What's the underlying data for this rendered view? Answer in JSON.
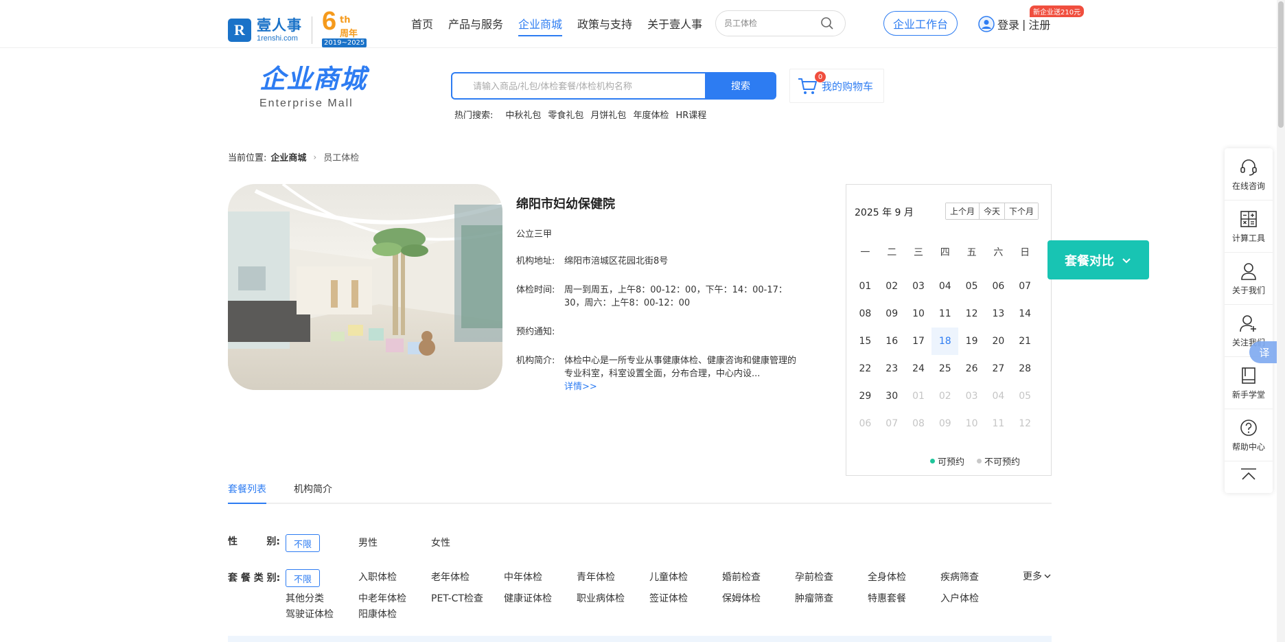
{
  "topnav": {
    "logo_cn": "壹人事",
    "logo_en": "1renshi.com",
    "anniv_num": "6",
    "anniv_th": "th",
    "anniv_zn": "周年",
    "anniv_years": "2019~2025",
    "links": [
      {
        "label": "首页"
      },
      {
        "label": "产品与服务"
      },
      {
        "label": "企业商城"
      },
      {
        "label": "政策与支持"
      },
      {
        "label": "关于壹人事"
      }
    ],
    "active_link": "企业商城",
    "search_placeholder": "员工体检",
    "workbench": "企业工作台",
    "login": "登录",
    "separator": "|",
    "register": "注册",
    "promo": "新企业送210元"
  },
  "mall": {
    "title_cn": "企业商城",
    "title_en": "Enterprise Mall",
    "search_placeholder": "请输入商品/礼包/体检套餐/体检机构名称",
    "search_button": "搜索",
    "hot_label": "热门搜索:",
    "hot_items": [
      "中秋礼包",
      "零食礼包",
      "月饼礼包",
      "年度体检",
      "HR课程"
    ],
    "cart_label": "我的购物车",
    "cart_count": "0"
  },
  "breadcrumb": {
    "prefix": "当前位置:",
    "mall": "企业商城",
    "current": "员工体检"
  },
  "institution": {
    "name": "绵阳市妇幼保健院",
    "grade": "公立三甲",
    "address_label": "机构地址:",
    "address": "绵阳市涪城区花园北街8号",
    "hours_label": "体检时间:",
    "hours": "周一到周五，上午8：00-12：00，下午：14：00-17：30，周六：上午8：00-12：00",
    "notice_label": "预约通知:",
    "notice": "",
    "intro_label": "机构简介:",
    "intro": "体检中心是一所专业从事健康体检、健康咨询和健康管理的专业科室，科室设置全面，分布合理，中心内设...",
    "detail_link": "详情>>"
  },
  "calendar": {
    "month_label": "2025 年 9 月",
    "prev_month": "上个月",
    "today": "今天",
    "next_month": "下个月",
    "weekdays": [
      "一",
      "二",
      "三",
      "四",
      "五",
      "六",
      "日"
    ],
    "days": [
      {
        "d": "01",
        "m": false
      },
      {
        "d": "02",
        "m": false
      },
      {
        "d": "03",
        "m": false
      },
      {
        "d": "04",
        "m": false
      },
      {
        "d": "05",
        "m": false
      },
      {
        "d": "06",
        "m": false
      },
      {
        "d": "07",
        "m": false
      },
      {
        "d": "08",
        "m": false
      },
      {
        "d": "09",
        "m": false
      },
      {
        "d": "10",
        "m": false
      },
      {
        "d": "11",
        "m": false
      },
      {
        "d": "12",
        "m": false
      },
      {
        "d": "13",
        "m": false
      },
      {
        "d": "14",
        "m": false
      },
      {
        "d": "15",
        "m": false
      },
      {
        "d": "16",
        "m": false
      },
      {
        "d": "17",
        "m": false
      },
      {
        "d": "18",
        "m": false,
        "today": true
      },
      {
        "d": "19",
        "m": false
      },
      {
        "d": "20",
        "m": false
      },
      {
        "d": "21",
        "m": false
      },
      {
        "d": "22",
        "m": false
      },
      {
        "d": "23",
        "m": false
      },
      {
        "d": "24",
        "m": false
      },
      {
        "d": "25",
        "m": false
      },
      {
        "d": "26",
        "m": false
      },
      {
        "d": "27",
        "m": false
      },
      {
        "d": "28",
        "m": false
      },
      {
        "d": "29",
        "m": false
      },
      {
        "d": "30",
        "m": false
      },
      {
        "d": "01",
        "m": true
      },
      {
        "d": "02",
        "m": true
      },
      {
        "d": "03",
        "m": true
      },
      {
        "d": "04",
        "m": true
      },
      {
        "d": "05",
        "m": true
      },
      {
        "d": "06",
        "m": true
      },
      {
        "d": "07",
        "m": true
      },
      {
        "d": "08",
        "m": true
      },
      {
        "d": "09",
        "m": true
      },
      {
        "d": "10",
        "m": true
      },
      {
        "d": "11",
        "m": true
      },
      {
        "d": "12",
        "m": true
      }
    ],
    "legend_available": "可预约",
    "legend_unavailable": "不可预约",
    "available_color": "#1fc59b",
    "unavailable_color": "#c8c8c8"
  },
  "compare": {
    "label": "套餐对比"
  },
  "side_tools": [
    {
      "label": "在线咨询",
      "icon": "headset-icon"
    },
    {
      "label": "计算工具",
      "icon": "calculator-icon"
    },
    {
      "label": "关于我们",
      "icon": "person-icon"
    },
    {
      "label": "关注我们",
      "icon": "person-add-icon"
    },
    {
      "label": "新手学堂",
      "icon": "book-icon"
    },
    {
      "label": "帮助中心",
      "icon": "help-icon"
    }
  ],
  "translate": "译",
  "tabs": [
    {
      "label": "套餐列表"
    },
    {
      "label": "机构简介"
    }
  ],
  "filters": {
    "gender_label_a": "性",
    "gender_label_b": "别:",
    "gender_selected": "不限",
    "gender_options": [
      "男性",
      "女性"
    ],
    "category_label": "套 餐 类 别:",
    "category_selected": "不限",
    "category_row1": [
      "入职体检",
      "老年体检",
      "中年体检",
      "青年体检",
      "儿童体检",
      "婚前检查",
      "孕前检查",
      "全身体检",
      "疾病筛查"
    ],
    "category_row2": [
      "其他分类",
      "中老年体检",
      "PET-CT检查",
      "健康证体检",
      "职业病体检",
      "签证体检",
      "保姆体检",
      "肿瘤筛查",
      "特惠套餐",
      "入户体检"
    ],
    "category_row3": [
      "驾驶证体检",
      "阳康体检"
    ],
    "more": "更多"
  },
  "colors": {
    "accent": "#2d7cf2",
    "compare": "#18c4b3",
    "badge": "#f04e3e",
    "logo": "#1a72c8",
    "anniversary": "#f59a1c"
  }
}
